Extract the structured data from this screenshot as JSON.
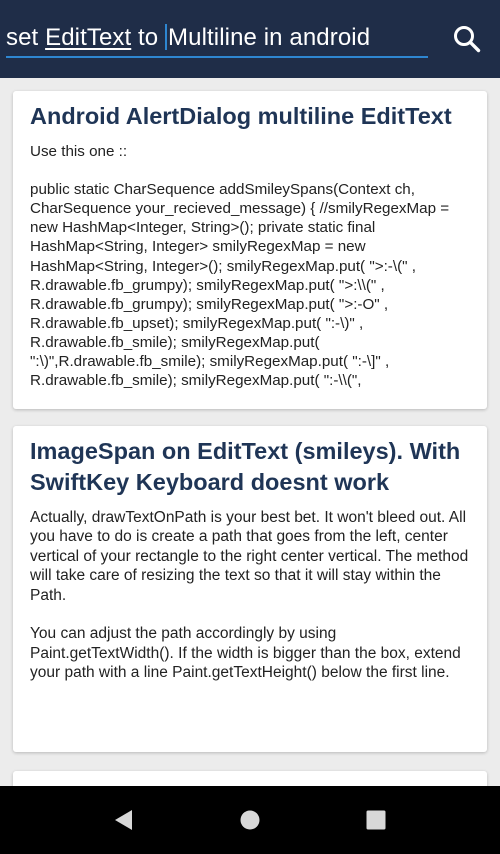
{
  "search": {
    "before": "set ",
    "underlined": "EditText",
    "middle": " to ",
    "after": "Multiline in android",
    "icon": "search-icon"
  },
  "results": [
    {
      "title": "Android AlertDialog multiline EditText",
      "body": "Use this one ::\n\npublic static CharSequence addSmileySpans(Context ch, CharSequence your_recieved_message) { //smilyRegexMap = new HashMap<Integer, String>(); private static final HashMap<String, Integer> smilyRegexMap = new HashMap<String, Integer>(); smilyRegexMap.put( \">:-\\(\" , R.drawable.fb_grumpy); smilyRegexMap.put( \">:\\\\(\" , R.drawable.fb_grumpy); smilyRegexMap.put( \">:-O\" , R.drawable.fb_upset); smilyRegexMap.put( \":-\\)\" , R.drawable.fb_smile); smilyRegexMap.put( \":\\)\",R.drawable.fb_smile); smilyRegexMap.put( \":-\\]\" , R.drawable.fb_smile); smilyRegexMap.put( \":-\\\\(\","
    },
    {
      "title": "ImageSpan on EditText (smileys). With SwiftKey Keyboard doesnt work",
      "body": "Actually, drawTextOnPath is your best bet. It won't bleed out. All you have to do is create a path that goes from the left, center vertical of your rectangle to the right center vertical. The method will take care of resizing the text so that it will stay within the Path.\n\nYou can adjust the path accordingly by using Paint.getTextWidth(). If the width is bigger than the box, extend your path with a line Paint.getTextHeight() below the first line."
    }
  ],
  "navbar": {
    "back_icon": "back-icon",
    "home_icon": "home-icon",
    "recents_icon": "recents-icon"
  },
  "colors": {
    "topbar": "#1f2d48",
    "accent": "#2e86d1",
    "title": "#1f3556",
    "background": "#ececec"
  }
}
